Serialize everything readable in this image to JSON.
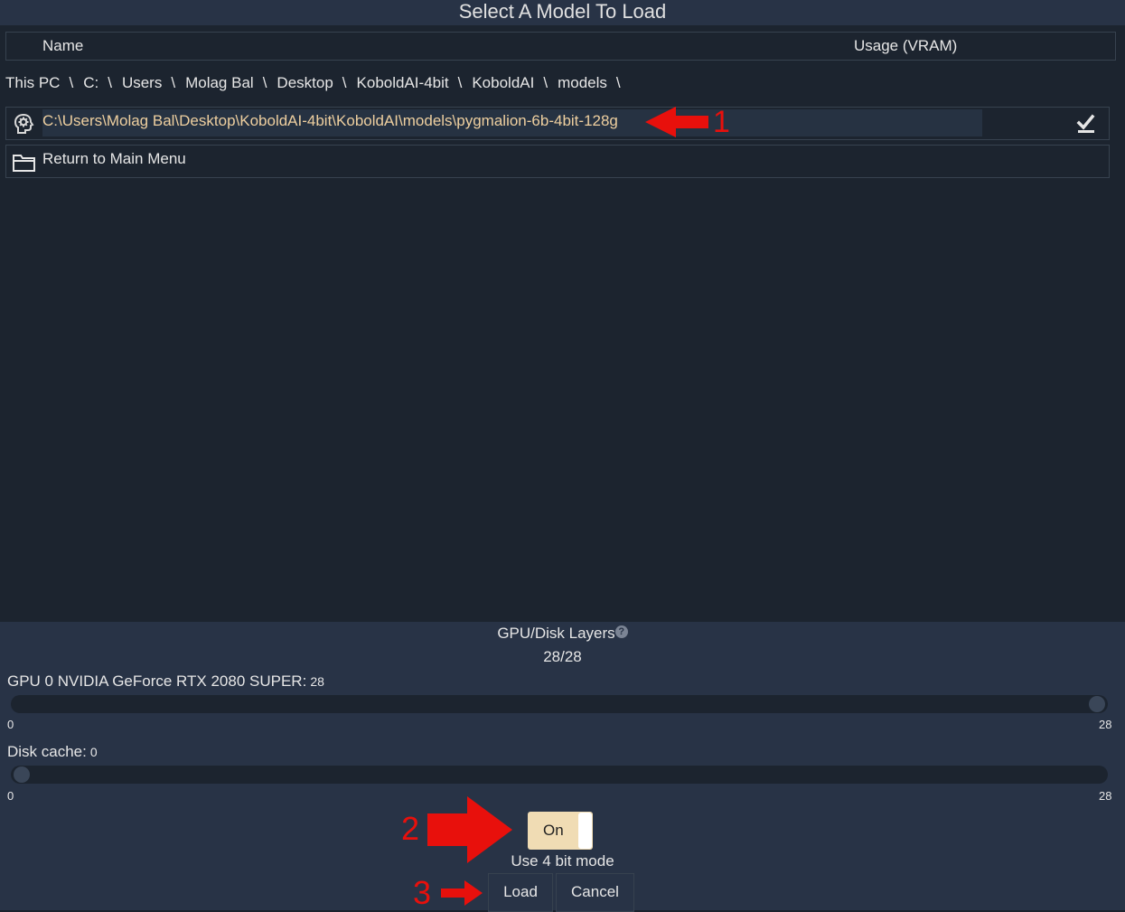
{
  "dialog": {
    "title": "Select A Model To Load"
  },
  "columns": {
    "name": "Name",
    "usage": "Usage (VRAM)"
  },
  "breadcrumb": [
    "This PC",
    "C:",
    "Users",
    "Molag Bal",
    "Desktop",
    "KoboldAI-4bit",
    "KoboldAI",
    "models"
  ],
  "breadcrumb_separator": "\\",
  "rows": {
    "model_path": "C:\\Users\\Molag Bal\\Desktop\\KoboldAI-4bit\\KoboldAI\\models\\pygmalion-6b-4bit-128g",
    "model_icon": "brain-gear-icon",
    "check_icon": "check-icon",
    "return_label": "Return to Main Menu",
    "return_icon": "folder-icon"
  },
  "layers": {
    "title": "GPU/Disk Layers",
    "help_icon": "?",
    "count": "28/28",
    "gpu": {
      "label": "GPU 0 NVIDIA GeForce RTX 2080 SUPER:",
      "value": "28",
      "min": "0",
      "max": "28",
      "level": 1.0
    },
    "disk": {
      "label": "Disk cache:",
      "value": "0",
      "min": "0",
      "max": "28",
      "level": 0.0
    }
  },
  "bit_mode": {
    "toggle_label": "On",
    "caption": "Use 4 bit mode"
  },
  "buttons": {
    "load": "Load",
    "cancel": "Cancel"
  },
  "annotations": {
    "one": "1",
    "two": "2",
    "three": "3",
    "color": "#e8100c"
  },
  "colors": {
    "background": "#1c242f",
    "header": "#283346",
    "path_text": "#eecf9f",
    "toggle_on": "#f0dcb4"
  }
}
